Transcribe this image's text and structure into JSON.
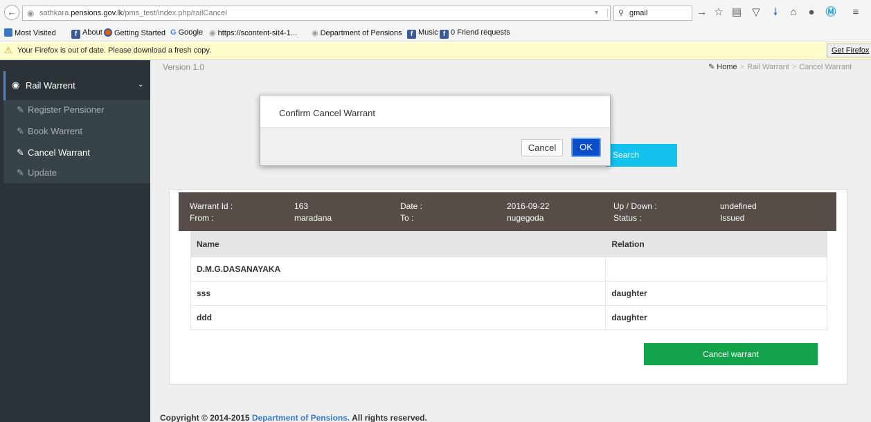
{
  "browser": {
    "url_prefix": "sathkara.",
    "url_domain": "pensions.gov.lk",
    "url_path": "/pms_test/index.php/railCancel",
    "search_value": "gmail",
    "bookmarks": [
      {
        "label": "Most Visited",
        "icon": "most-visited-icon"
      },
      {
        "label": "About",
        "icon": "facebook-icon"
      },
      {
        "label": "Getting Started",
        "icon": "firefox-icon"
      },
      {
        "label": "Google",
        "icon": "google-icon"
      },
      {
        "label": "https://scontent-sit4-1...",
        "icon": "globe-icon"
      },
      {
        "label": "Department of Pensions",
        "icon": "globe-icon"
      },
      {
        "label": "Music",
        "icon": "facebook-icon"
      },
      {
        "label": "0 Friend requests",
        "icon": "facebook-icon"
      }
    ],
    "notification": {
      "text": "Your Firefox is out of date. Please download a fresh copy.",
      "button": "Get Firefox"
    }
  },
  "sidebar": {
    "section": "Rail Warrent",
    "items": [
      {
        "label": "Register Pensioner",
        "active": false
      },
      {
        "label": "Book Warrent",
        "active": false
      },
      {
        "label": "Cancel Warrant",
        "active": true
      },
      {
        "label": "Update",
        "active": false
      }
    ]
  },
  "header": {
    "version": "Version 1.0",
    "breadcrumb": [
      "Home",
      "Rail Warrant",
      "Cancel Warrant"
    ]
  },
  "search_button": "Search",
  "warrant": {
    "warrant_id_label": "Warrant Id :",
    "warrant_id": "163",
    "date_label": "Date :",
    "date": "2016-09-22",
    "updown_label": "Up / Down :",
    "updown": "undefined",
    "from_label": "From :",
    "from": "maradana",
    "to_label": "To :",
    "to": "nugegoda",
    "status_label": "Status :",
    "status": "Issued"
  },
  "table": {
    "headers": [
      "Name",
      "Relation"
    ],
    "rows": [
      [
        "D.M.G.DASANAYAKA",
        ""
      ],
      [
        "sss",
        "daughter"
      ],
      [
        "ddd",
        "daughter"
      ]
    ]
  },
  "cancel_warrant_button": "Cancel warrant",
  "footer": {
    "prefix": "Copyright © 2014-2015 ",
    "link": "Department of Pensions.",
    "suffix": " All rights reserved."
  },
  "modal": {
    "title": "Confirm Cancel Warrant",
    "cancel": "Cancel",
    "ok": "OK"
  }
}
